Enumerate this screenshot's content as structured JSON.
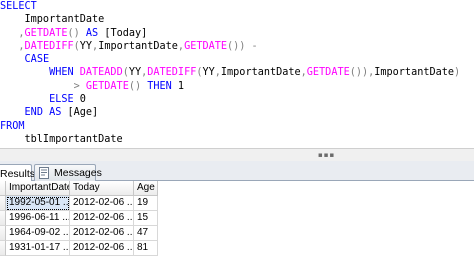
{
  "editor": {
    "lines": [
      [
        {
          "t": "SELECT",
          "c": "kw"
        }
      ],
      [
        {
          "t": "    ImportantDate",
          "c": "txt"
        }
      ],
      [
        {
          "t": "   ",
          "c": "txt"
        },
        {
          "t": ",",
          "c": "op"
        },
        {
          "t": "GETDATE",
          "c": "fn"
        },
        {
          "t": "()",
          "c": "op"
        },
        {
          "t": " ",
          "c": "txt"
        },
        {
          "t": "AS",
          "c": "kw"
        },
        {
          "t": " [Today]",
          "c": "txt"
        }
      ],
      [
        {
          "t": "   ",
          "c": "txt"
        },
        {
          "t": ",",
          "c": "op"
        },
        {
          "t": "DATEDIFF",
          "c": "fn"
        },
        {
          "t": "(",
          "c": "op"
        },
        {
          "t": "YY",
          "c": "txt"
        },
        {
          "t": ",",
          "c": "op"
        },
        {
          "t": "ImportantDate",
          "c": "txt"
        },
        {
          "t": ",",
          "c": "op"
        },
        {
          "t": "GETDATE",
          "c": "fn"
        },
        {
          "t": "())",
          "c": "op"
        },
        {
          "t": " ",
          "c": "txt"
        },
        {
          "t": "-",
          "c": "op"
        }
      ],
      [
        {
          "t": "    ",
          "c": "txt"
        },
        {
          "t": "CASE",
          "c": "kw"
        }
      ],
      [
        {
          "t": "        ",
          "c": "txt"
        },
        {
          "t": "WHEN",
          "c": "kw"
        },
        {
          "t": " ",
          "c": "txt"
        },
        {
          "t": "DATEADD",
          "c": "fn"
        },
        {
          "t": "(",
          "c": "op"
        },
        {
          "t": "YY",
          "c": "txt"
        },
        {
          "t": ",",
          "c": "op"
        },
        {
          "t": "DATEDIFF",
          "c": "fn"
        },
        {
          "t": "(",
          "c": "op"
        },
        {
          "t": "YY",
          "c": "txt"
        },
        {
          "t": ",",
          "c": "op"
        },
        {
          "t": "ImportantDate",
          "c": "txt"
        },
        {
          "t": ",",
          "c": "op"
        },
        {
          "t": "GETDATE",
          "c": "fn"
        },
        {
          "t": "())",
          "c": "op"
        },
        {
          "t": ",",
          "c": "op"
        },
        {
          "t": "ImportantDate",
          "c": "txt"
        },
        {
          "t": ")",
          "c": "op"
        }
      ],
      [
        {
          "t": "            ",
          "c": "txt"
        },
        {
          "t": ">",
          "c": "op"
        },
        {
          "t": " ",
          "c": "txt"
        },
        {
          "t": "GETDATE",
          "c": "fn"
        },
        {
          "t": "()",
          "c": "op"
        },
        {
          "t": " ",
          "c": "txt"
        },
        {
          "t": "THEN",
          "c": "kw"
        },
        {
          "t": " 1",
          "c": "txt"
        }
      ],
      [
        {
          "t": "        ",
          "c": "txt"
        },
        {
          "t": "ELSE",
          "c": "kw"
        },
        {
          "t": " 0",
          "c": "txt"
        }
      ],
      [
        {
          "t": "    ",
          "c": "txt"
        },
        {
          "t": "END",
          "c": "kw"
        },
        {
          "t": " ",
          "c": "txt"
        },
        {
          "t": "AS",
          "c": "kw"
        },
        {
          "t": " [Age]",
          "c": "txt"
        }
      ],
      [
        {
          "t": "FROM",
          "c": "kw"
        }
      ],
      [
        {
          "t": "    tblImportantDate",
          "c": "txt"
        }
      ]
    ]
  },
  "splitter": {
    "grip": "▪▪▪"
  },
  "tabs": {
    "results_label": "Results",
    "messages_label": "Messages"
  },
  "grid": {
    "columns": [
      "ImportantDate",
      "Today",
      "Age"
    ],
    "rows": [
      [
        "1992-05-01 ...",
        "2012-02-06 ...",
        "19"
      ],
      [
        "1996-06-11 ...",
        "2012-02-06 ...",
        "15"
      ],
      [
        "1964-09-02 ...",
        "2012-02-06 ...",
        "47"
      ],
      [
        "1931-01-17 ...",
        "2012-02-06 ...",
        "81"
      ]
    ]
  },
  "colors": {
    "keyword": "#0000ff",
    "function": "#ff00ff",
    "operator": "#808080",
    "selected_cell": "#d9e6f6"
  }
}
